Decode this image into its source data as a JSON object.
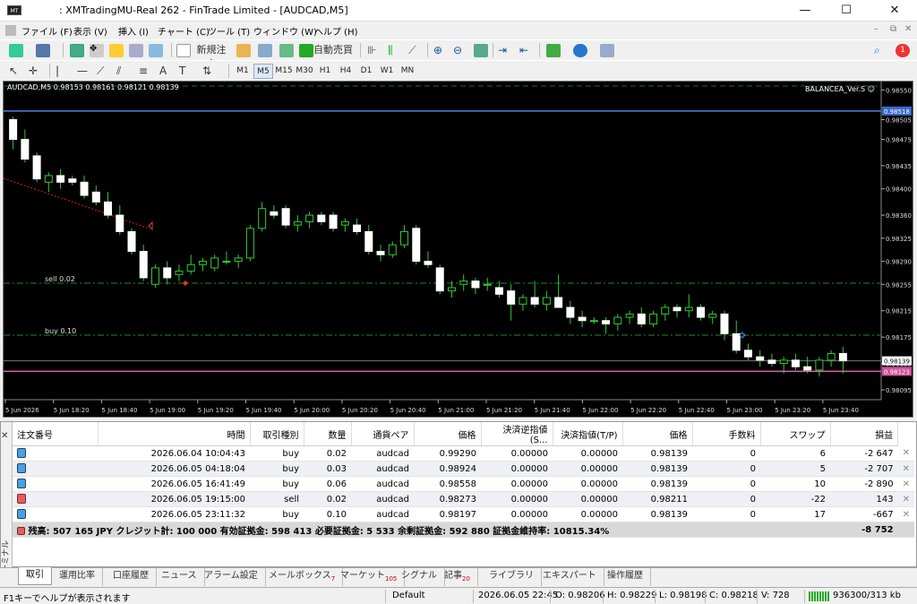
{
  "window": {
    "title": ": XMTradingMU-Real 262 - FinTrade Limited - [AUDCAD,M5]",
    "minimize": "—",
    "maximize": "☐",
    "close": "✕"
  },
  "menu": [
    "ファイル (F)",
    "表示 (V)",
    "挿入 (I)",
    "チャート (C)",
    "ツール (T)",
    "ウィンドウ (W)",
    "ヘルプ (H)"
  ],
  "toolbar": {
    "new_order": "新規注文",
    "auto_trade": "自動売買",
    "timeframes": [
      "M1",
      "M5",
      "M15",
      "M30",
      "H1",
      "H4",
      "D1",
      "W1",
      "MN"
    ],
    "active_tf": "M5",
    "notification_count": "1"
  },
  "chart": {
    "symbol_info": "AUDCAD,M5  0.98153 0.98161 0.98121 0.98139",
    "ea_name": "BALANCEA_Ver.S ☺",
    "sell_label": "sell 0.02",
    "buy_label": "buy 0.10",
    "price_ticks": [
      "0.98550",
      "0.98505",
      "0.98475",
      "0.98435",
      "0.98400",
      "0.98360",
      "0.98325",
      "0.98290",
      "0.98255",
      "0.98215",
      "0.98175",
      "0.98135",
      "0.98095"
    ],
    "current_price": "0.98139",
    "blue_level": "0.98518",
    "pink_level": "0.98123",
    "time_ticks": [
      "5 Jun 2026",
      "5 Jun 18:20",
      "5 Jun 18:40",
      "5 Jun 19:00",
      "5 Jun 19:20",
      "5 Jun 19:40",
      "5 Jun 20:00",
      "5 Jun 20:20",
      "5 Jun 20:40",
      "5 Jun 21:00",
      "5 Jun 21:20",
      "5 Jun 21:40",
      "5 Jun 22:00",
      "5 Jun 22:20",
      "5 Jun 22:40",
      "5 Jun 23:00",
      "5 Jun 23:20",
      "5 Jun 23:40"
    ]
  },
  "chart_data": {
    "type": "candlestick",
    "ylim": [
      0.9808,
      0.9856
    ],
    "candles": [
      [
        0.98505,
        0.9851,
        0.9846,
        0.98475
      ],
      [
        0.98475,
        0.9849,
        0.9844,
        0.98445
      ],
      [
        0.9845,
        0.98455,
        0.9841,
        0.98415
      ],
      [
        0.9841,
        0.98425,
        0.98395,
        0.9842
      ],
      [
        0.9842,
        0.9843,
        0.984,
        0.9841
      ],
      [
        0.98415,
        0.9842,
        0.98405,
        0.9841
      ],
      [
        0.9841,
        0.9842,
        0.98385,
        0.9839
      ],
      [
        0.98395,
        0.98405,
        0.98375,
        0.9838
      ],
      [
        0.9838,
        0.98395,
        0.98355,
        0.9836
      ],
      [
        0.9836,
        0.98375,
        0.9833,
        0.98335
      ],
      [
        0.98335,
        0.9834,
        0.983,
        0.98305
      ],
      [
        0.98305,
        0.98315,
        0.9826,
        0.98265
      ],
      [
        0.98255,
        0.98285,
        0.9825,
        0.9828
      ],
      [
        0.9828,
        0.9829,
        0.98255,
        0.98265
      ],
      [
        0.9827,
        0.98285,
        0.9826,
        0.98275
      ],
      [
        0.98275,
        0.983,
        0.9827,
        0.98285
      ],
      [
        0.98285,
        0.98295,
        0.98275,
        0.9829
      ],
      [
        0.9828,
        0.983,
        0.98275,
        0.98295
      ],
      [
        0.9829,
        0.98305,
        0.98285,
        0.9829
      ],
      [
        0.9829,
        0.983,
        0.9828,
        0.98295
      ],
      [
        0.98295,
        0.98345,
        0.9829,
        0.9834
      ],
      [
        0.9834,
        0.9838,
        0.98335,
        0.9837
      ],
      [
        0.98365,
        0.98375,
        0.98355,
        0.9836
      ],
      [
        0.9837,
        0.98375,
        0.9834,
        0.98345
      ],
      [
        0.98345,
        0.9836,
        0.98335,
        0.9835
      ],
      [
        0.9835,
        0.98365,
        0.9834,
        0.9836
      ],
      [
        0.9836,
        0.98365,
        0.98345,
        0.9835
      ],
      [
        0.9836,
        0.98365,
        0.98335,
        0.9834
      ],
      [
        0.98345,
        0.98355,
        0.98335,
        0.9835
      ],
      [
        0.98345,
        0.98355,
        0.9833,
        0.98335
      ],
      [
        0.98335,
        0.98345,
        0.983,
        0.98305
      ],
      [
        0.98305,
        0.98315,
        0.9829,
        0.983
      ],
      [
        0.983,
        0.9832,
        0.98295,
        0.98315
      ],
      [
        0.98315,
        0.98345,
        0.9831,
        0.98335
      ],
      [
        0.9834,
        0.98345,
        0.98285,
        0.9829
      ],
      [
        0.9829,
        0.98305,
        0.9828,
        0.98285
      ],
      [
        0.9828,
        0.98285,
        0.9824,
        0.98245
      ],
      [
        0.98245,
        0.9826,
        0.98235,
        0.9825
      ],
      [
        0.98255,
        0.9827,
        0.98245,
        0.9826
      ],
      [
        0.9826,
        0.98265,
        0.9824,
        0.9825
      ],
      [
        0.98255,
        0.98265,
        0.98245,
        0.98255
      ],
      [
        0.9825,
        0.9826,
        0.98235,
        0.9824
      ],
      [
        0.98245,
        0.98255,
        0.982,
        0.98225
      ],
      [
        0.98225,
        0.9824,
        0.98215,
        0.98235
      ],
      [
        0.98235,
        0.9826,
        0.9822,
        0.98225
      ],
      [
        0.98225,
        0.98245,
        0.98215,
        0.98235
      ],
      [
        0.98235,
        0.9827,
        0.98225,
        0.9822
      ],
      [
        0.9822,
        0.9823,
        0.98195,
        0.98205
      ],
      [
        0.98205,
        0.98215,
        0.9819,
        0.982
      ],
      [
        0.982,
        0.98205,
        0.98195,
        0.982
      ],
      [
        0.982,
        0.98205,
        0.9818,
        0.98195
      ],
      [
        0.98195,
        0.9821,
        0.98185,
        0.98205
      ],
      [
        0.98205,
        0.98215,
        0.98195,
        0.9821
      ],
      [
        0.9821,
        0.9822,
        0.9819,
        0.98195
      ],
      [
        0.98195,
        0.98215,
        0.9819,
        0.9821
      ],
      [
        0.9821,
        0.98225,
        0.982,
        0.9822
      ],
      [
        0.9822,
        0.98225,
        0.98205,
        0.98215
      ],
      [
        0.98215,
        0.9824,
        0.98205,
        0.9822
      ],
      [
        0.9822,
        0.98225,
        0.982,
        0.98205
      ],
      [
        0.98205,
        0.98215,
        0.98195,
        0.9821
      ],
      [
        0.9821,
        0.98215,
        0.9817,
        0.9818
      ],
      [
        0.9818,
        0.982,
        0.9815,
        0.98155
      ],
      [
        0.98155,
        0.98165,
        0.9814,
        0.98145
      ],
      [
        0.98145,
        0.98155,
        0.9813,
        0.9814
      ],
      [
        0.9814,
        0.9815,
        0.9813,
        0.98135
      ],
      [
        0.98135,
        0.98145,
        0.9812,
        0.9814
      ],
      [
        0.9814,
        0.9815,
        0.98125,
        0.9813
      ],
      [
        0.9813,
        0.98145,
        0.9812,
        0.98125
      ],
      [
        0.98125,
        0.98145,
        0.98115,
        0.9814
      ],
      [
        0.9814,
        0.98155,
        0.9813,
        0.9815
      ],
      [
        0.9815,
        0.9816,
        0.9812,
        0.98139
      ]
    ]
  },
  "table": {
    "headers": [
      "注文番号",
      "/",
      "時間",
      "取引種別",
      "数量",
      "通貨ペア",
      "価格",
      "決済逆指値(S...",
      "決済指値(T/P)",
      "価格",
      "手数料",
      "スワップ",
      "損益"
    ],
    "rows": [
      {
        "time": "2026.06.04 10:04:43",
        "type": "buy",
        "vol": "0.02",
        "pair": "audcad",
        "price": "0.99290",
        "sl": "0.00000",
        "tp": "0.00000",
        "cur": "0.98139",
        "comm": "0",
        "swap": "6",
        "pnl": "-2 647"
      },
      {
        "time": "2026.06.05 04:18:04",
        "type": "buy",
        "vol": "0.03",
        "pair": "audcad",
        "price": "0.98924",
        "sl": "0.00000",
        "tp": "0.00000",
        "cur": "0.98139",
        "comm": "0",
        "swap": "5",
        "pnl": "-2 707"
      },
      {
        "time": "2026.06.05 16:41:49",
        "type": "buy",
        "vol": "0.06",
        "pair": "audcad",
        "price": "0.98558",
        "sl": "0.00000",
        "tp": "0.00000",
        "cur": "0.98139",
        "comm": "0",
        "swap": "10",
        "pnl": "-2 890"
      },
      {
        "time": "2026.06.05 19:15:00",
        "type": "sell",
        "vol": "0.02",
        "pair": "audcad",
        "price": "0.98273",
        "sl": "0.00000",
        "tp": "0.00000",
        "cur": "0.98211",
        "comm": "0",
        "swap": "-22",
        "pnl": "143"
      },
      {
        "time": "2026.06.05 23:11:32",
        "type": "buy",
        "vol": "0.10",
        "pair": "audcad",
        "price": "0.98197",
        "sl": "0.00000",
        "tp": "0.00000",
        "cur": "0.98139",
        "comm": "0",
        "swap": "17",
        "pnl": "-667"
      }
    ],
    "balance_text": "残高: 507 165 JPY  クレジット計: 100 000  有効証拠金: 598 413  必要証拠金: 5 533  余剰証拠金: 592 880  証拠金維持率: 10815.34%",
    "total_pnl": "-8 752"
  },
  "tabs": [
    {
      "label": "取引"
    },
    {
      "label": "運用比率"
    },
    {
      "label": "口座履歴"
    },
    {
      "label": "ニュース"
    },
    {
      "label": "アラーム設定"
    },
    {
      "label": "メールボックス",
      "badge": "7"
    },
    {
      "label": "マーケット",
      "badge": "105"
    },
    {
      "label": "シグナル"
    },
    {
      "label": "記事",
      "badge": "20"
    },
    {
      "label": "ライブラリ"
    },
    {
      "label": "エキスパート"
    },
    {
      "label": "操作履歴"
    }
  ],
  "terminal_side_label": "ターミナル",
  "statusbar": {
    "help": "F1キーでヘルプが表示されます",
    "profile": "Default",
    "datetime": "2026.06.05 22:45",
    "o": "O: 0.98206",
    "h": "H: 0.98229",
    "l": "L: 0.98198",
    "c": "C: 0.98218",
    "v": "V: 728",
    "traffic": "936300/313 kb"
  }
}
